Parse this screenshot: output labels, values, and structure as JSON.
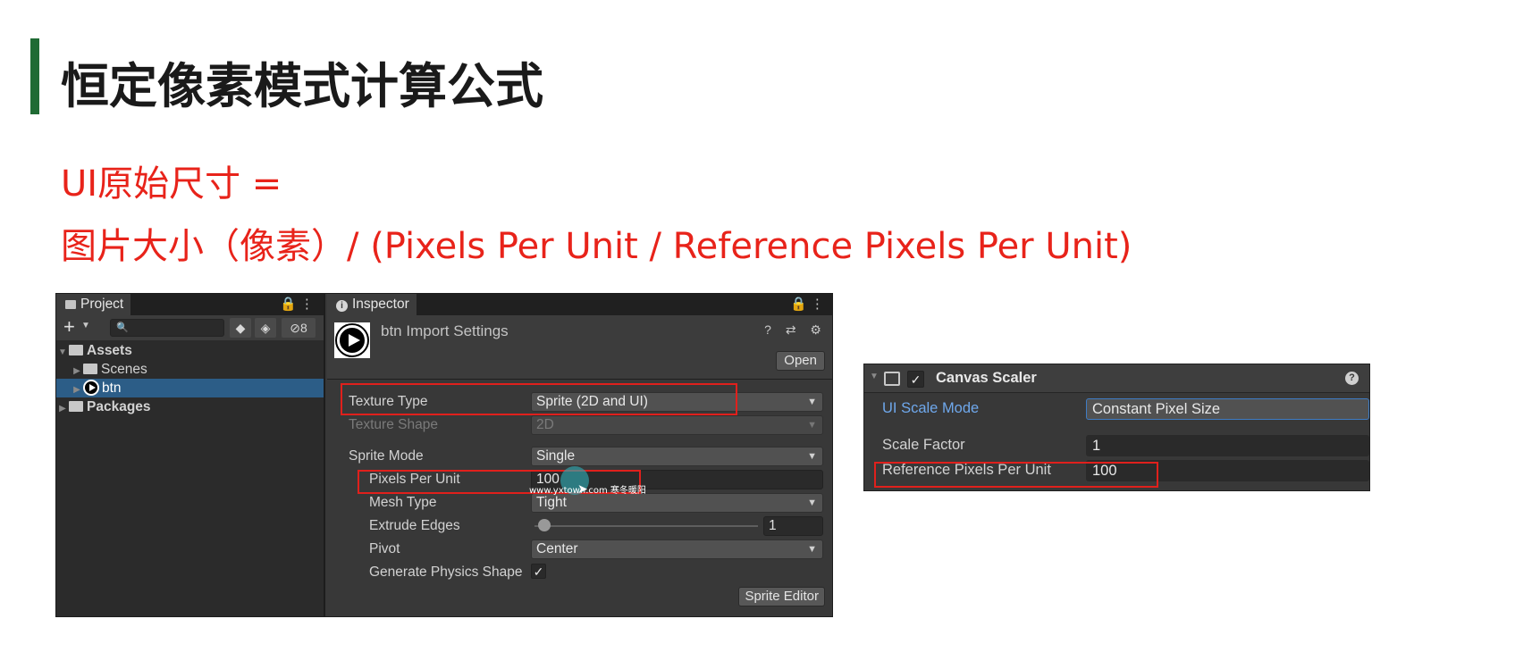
{
  "title": "恒定像素模式计算公式",
  "formula": {
    "line1": "UI原始尺寸 =",
    "line2": "图片大小（像素）/ (Pixels Per Unit / Reference Pixels Per Unit)"
  },
  "project": {
    "tab": "Project",
    "tab_icons": "🔒 ⋮",
    "search_placeholder": "🔍",
    "hidden_count": "8",
    "tree": [
      {
        "label": "Assets",
        "arrow": "▼"
      },
      {
        "label": "Scenes",
        "arrow": "▶"
      },
      {
        "label": "btn",
        "arrow": "▶"
      },
      {
        "label": "Packages",
        "arrow": "▶"
      }
    ]
  },
  "inspector": {
    "tab": "Inspector",
    "tab_icons": "🔒 ⋮",
    "asset_title": "btn Import Settings",
    "header_icons": "? ⇄ ⚙",
    "open_label": "Open",
    "rows": {
      "texture_type": {
        "label": "Texture Type",
        "value": "Sprite (2D and UI)"
      },
      "texture_shape": {
        "label": "Texture Shape",
        "value": "2D"
      },
      "sprite_mode": {
        "label": "Sprite Mode",
        "value": "Single"
      },
      "pixels_per_unit": {
        "label": "Pixels Per Unit",
        "value": "100"
      },
      "mesh_type": {
        "label": "Mesh Type",
        "value": "Tight"
      },
      "extrude_edges": {
        "label": "Extrude Edges",
        "value": "1",
        "level": 0.03
      },
      "pivot": {
        "label": "Pivot",
        "value": "Center"
      },
      "physics_shape": {
        "label": "Generate Physics Shape",
        "checked": "✓"
      }
    },
    "sprite_editor_label": "Sprite Editor",
    "watermark": "www.yxtown.com 寒冬暖阳"
  },
  "canvas_scaler": {
    "title": "Canvas Scaler",
    "enabled": "✓",
    "help": "?",
    "rows": {
      "ui_scale_mode": {
        "label": "UI Scale Mode",
        "value": "Constant Pixel Size"
      },
      "scale_factor": {
        "label": "Scale Factor",
        "value": "1"
      },
      "reference_ppu": {
        "label": "Reference Pixels Per Unit",
        "value": "100"
      }
    }
  },
  "colors": {
    "accent_bar": "#1f6b34",
    "formula_red": "#e8231a",
    "highlight_box": "#e0201c",
    "selection_blue": "#2c5d87"
  }
}
